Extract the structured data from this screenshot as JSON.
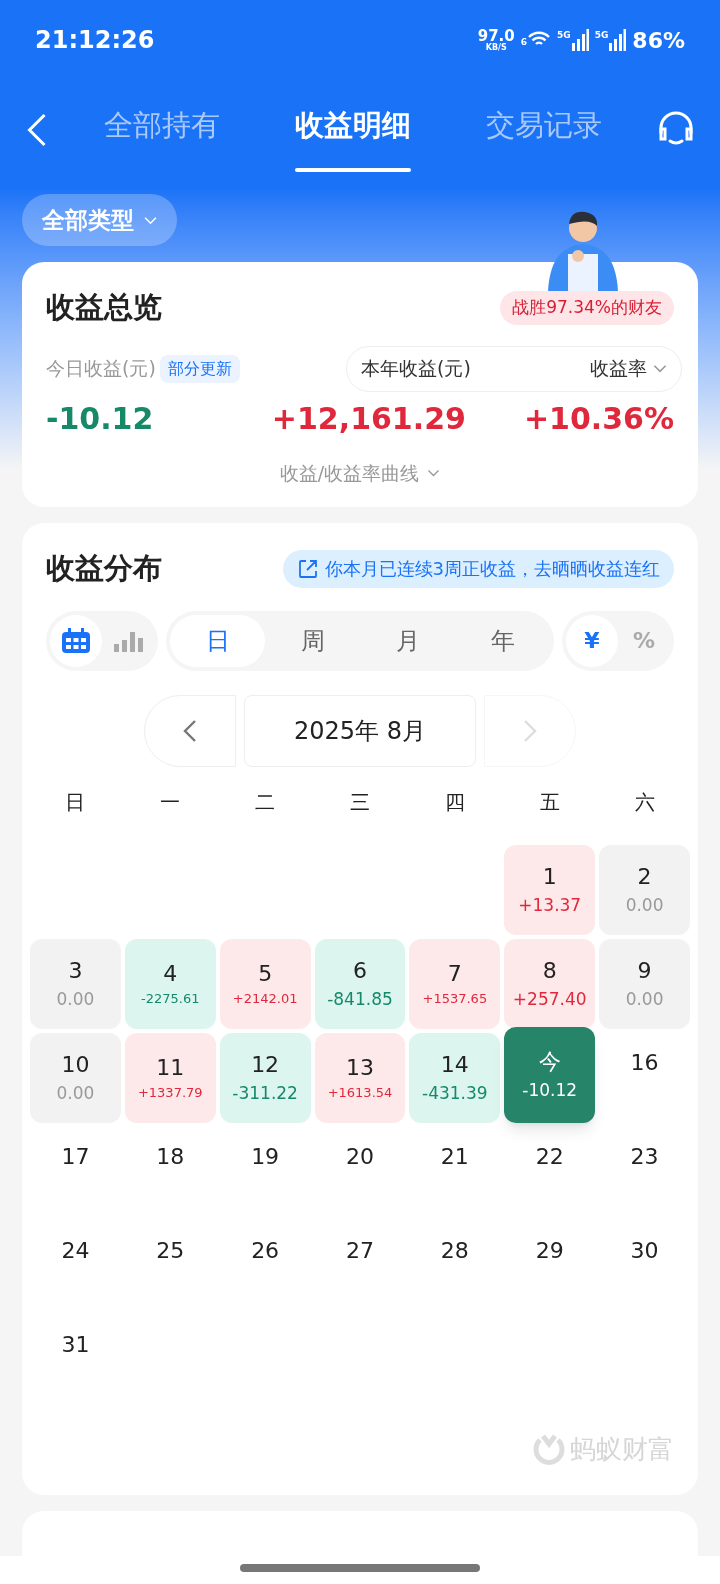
{
  "status_bar": {
    "time": "21:12:26",
    "net_speed": "97.0",
    "net_unit": "KB/S",
    "wifi_label": "6",
    "sim_labels": [
      "5G",
      "5G"
    ],
    "battery": "86%"
  },
  "tabs": [
    {
      "label": "全部持有",
      "selected": false
    },
    {
      "label": "收益明细",
      "selected": true
    },
    {
      "label": "交易记录",
      "selected": false
    }
  ],
  "filter": {
    "label": "全部类型"
  },
  "overview": {
    "title": "收益总览",
    "badge": "战胜97.34%的财友",
    "today_label": "今日收益(元)",
    "today_tag": "部分更新",
    "today_value": "-10.12",
    "year_label": "本年收益(元)",
    "rate_label": "收益率",
    "year_value": "+12,161.29",
    "rate_value": "+10.36%",
    "curve_link": "收益/收益率曲线"
  },
  "distribution": {
    "title": "收益分布",
    "banner": "你本月已连续3周正收益，去晒晒收益连红",
    "views": [
      {
        "kind": "calendar",
        "selected": true
      },
      {
        "kind": "bars",
        "selected": false
      }
    ],
    "periods": [
      {
        "label": "日",
        "selected": true
      },
      {
        "label": "周",
        "selected": false
      },
      {
        "label": "月",
        "selected": false
      },
      {
        "label": "年",
        "selected": false
      }
    ],
    "units": [
      {
        "label": "¥",
        "selected": true
      },
      {
        "label": "%",
        "selected": false
      }
    ],
    "month": "2025年 8月",
    "weekdays": [
      "日",
      "一",
      "二",
      "三",
      "四",
      "五",
      "六"
    ],
    "days": [
      {
        "kind": "blank"
      },
      {
        "kind": "blank"
      },
      {
        "kind": "blank"
      },
      {
        "kind": "blank"
      },
      {
        "kind": "blank"
      },
      {
        "kind": "gain",
        "day": "1",
        "value": "+13.37"
      },
      {
        "kind": "flat",
        "day": "2",
        "value": "0.00"
      },
      {
        "kind": "flat",
        "day": "3",
        "value": "0.00"
      },
      {
        "kind": "loss",
        "day": "4",
        "value": "-2275.61"
      },
      {
        "kind": "gain",
        "day": "5",
        "value": "+2142.01"
      },
      {
        "kind": "loss",
        "day": "6",
        "value": "-841.85"
      },
      {
        "kind": "gain",
        "day": "7",
        "value": "+1537.65"
      },
      {
        "kind": "gain",
        "day": "8",
        "value": "+257.40"
      },
      {
        "kind": "flat",
        "day": "9",
        "value": "0.00"
      },
      {
        "kind": "flat",
        "day": "10",
        "value": "0.00"
      },
      {
        "kind": "gain",
        "day": "11",
        "value": "+1337.79"
      },
      {
        "kind": "loss",
        "day": "12",
        "value": "-311.22"
      },
      {
        "kind": "gain",
        "day": "13",
        "value": "+1613.54"
      },
      {
        "kind": "loss",
        "day": "14",
        "value": "-431.39"
      },
      {
        "kind": "today",
        "day": "今",
        "value": "-10.12"
      },
      {
        "kind": "future",
        "day": "16"
      },
      {
        "kind": "future",
        "day": "17"
      },
      {
        "kind": "future",
        "day": "18"
      },
      {
        "kind": "future",
        "day": "19"
      },
      {
        "kind": "future",
        "day": "20"
      },
      {
        "kind": "future",
        "day": "21"
      },
      {
        "kind": "future",
        "day": "22"
      },
      {
        "kind": "future",
        "day": "23"
      },
      {
        "kind": "future",
        "day": "24"
      },
      {
        "kind": "future",
        "day": "25"
      },
      {
        "kind": "future",
        "day": "26"
      },
      {
        "kind": "future",
        "day": "27"
      },
      {
        "kind": "future",
        "day": "28"
      },
      {
        "kind": "future",
        "day": "29"
      },
      {
        "kind": "future",
        "day": "30"
      },
      {
        "kind": "future",
        "day": "31"
      }
    ],
    "watermark": "蚂蚁财富"
  }
}
